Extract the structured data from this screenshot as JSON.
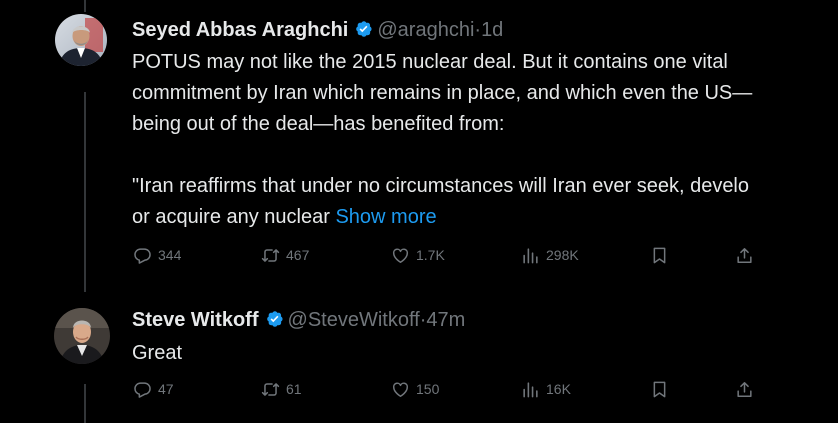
{
  "tweets": [
    {
      "name": "Seyed Abbas Araghchi",
      "handle": "@araghchi",
      "separator": "·",
      "time": "1d",
      "text_lines": [
        "POTUS may not like the 2015 nuclear deal. But it contains one vital",
        "commitment by Iran which remains in place, and which even the US—",
        "being out of the deal—has benefited from:",
        "",
        "\"Iran reaffirms that under no circumstances will Iran ever seek, develo",
        "or acquire any nuclear"
      ],
      "show_more": "Show more",
      "replies": "344",
      "reposts": "467",
      "likes": "1.7K",
      "views": "298K"
    },
    {
      "name": "Steve Witkoff",
      "handle": "@SteveWitkoff",
      "separator": "·",
      "time": "47m",
      "text_lines": [
        "Great"
      ],
      "replies": "47",
      "reposts": "61",
      "likes": "150",
      "views": "16K"
    }
  ],
  "icons": {
    "reply": "reply-icon",
    "repost": "repost-icon",
    "like": "heart-icon",
    "views": "views-icon",
    "bookmark": "bookmark-icon",
    "share": "share-icon",
    "verified": "verified-badge-icon"
  },
  "colors": {
    "background": "#000000",
    "text": "#e7e9ea",
    "muted": "#71767b",
    "link": "#1d9bf0",
    "verified": "#1d9bf0",
    "thread_line": "#333639"
  }
}
